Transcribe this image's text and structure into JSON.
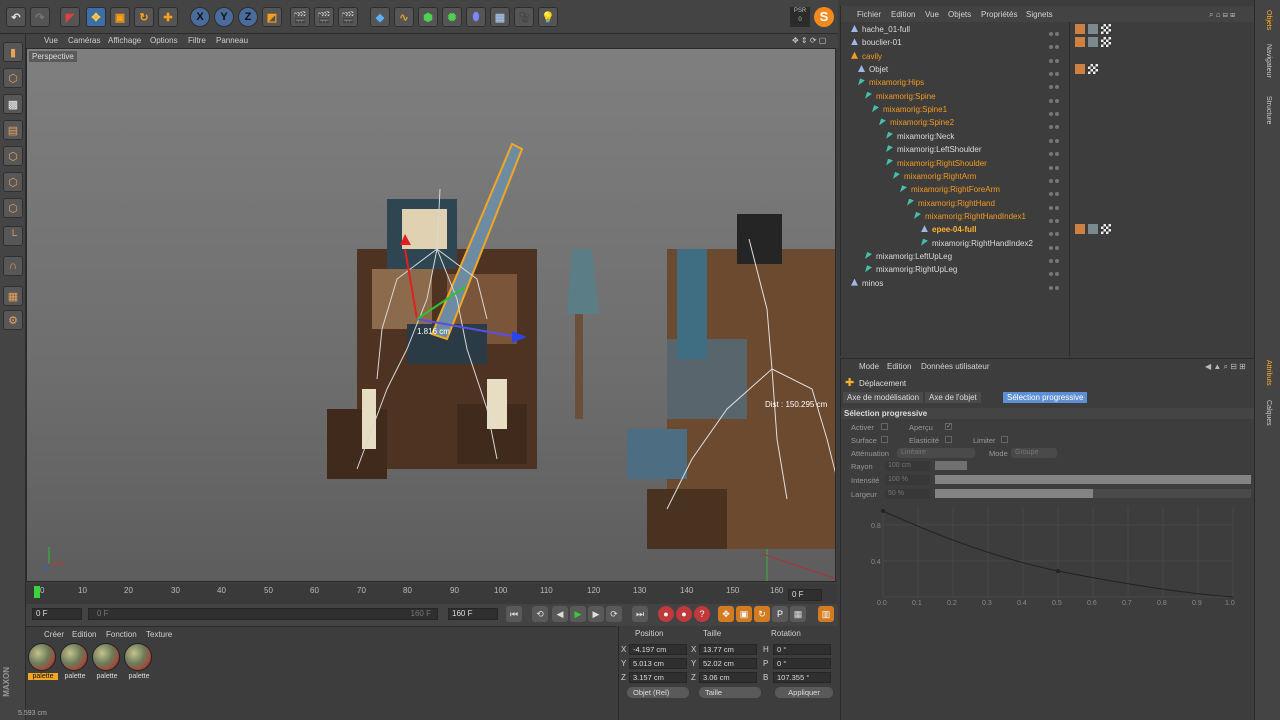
{
  "viewport": {
    "menu": [
      "Vue",
      "Caméras",
      "Affichage",
      "Options",
      "Filtre",
      "Panneau"
    ],
    "label": "Perspective",
    "dist_label_1": "1.816 cm",
    "dist_label_2": "Dist : 150.295 cm"
  },
  "toolbar": {
    "axis_x": "X",
    "axis_y": "Y",
    "axis_z": "Z",
    "logo": "S"
  },
  "timeline": {
    "ticks": [
      "0",
      "10",
      "20",
      "30",
      "40",
      "50",
      "60",
      "70",
      "80",
      "90",
      "100",
      "110",
      "120",
      "130",
      "140",
      "150",
      "160"
    ],
    "current_frame": "0 F",
    "start_field": "0 F",
    "range_start": "0 F",
    "range_end": "160 F",
    "end_field": "160 F"
  },
  "materials": {
    "menu": [
      "Créer",
      "Edition",
      "Fonction",
      "Texture"
    ],
    "items": [
      "palette",
      "palette",
      "palette",
      "palette"
    ]
  },
  "coords": {
    "headers": {
      "position": "Position",
      "size": "Taille",
      "rotation": "Rotation"
    },
    "rows": [
      {
        "axis": "X",
        "pos": "-4.197 cm",
        "size_axis": "X",
        "size": "13.77 cm",
        "rot_axis": "H",
        "rot": "0 °"
      },
      {
        "axis": "Y",
        "pos": "5.013 cm",
        "size_axis": "Y",
        "size": "52.02 cm",
        "rot_axis": "P",
        "rot": "0 °"
      },
      {
        "axis": "Z",
        "pos": "3.157 cm",
        "size_axis": "Z",
        "size": "3.06 cm",
        "rot_axis": "B",
        "rot": "107.355 °"
      }
    ],
    "mode_dropdown": "Objet (Rel)",
    "size_dropdown": "Taille",
    "apply_button": "Appliquer"
  },
  "objects": {
    "menu": [
      "Fichier",
      "Edition",
      "Vue",
      "Objets",
      "Propriétés",
      "Signets"
    ],
    "rows": [
      {
        "name": "hache_01-full",
        "style": "norm",
        "indent": 0
      },
      {
        "name": "bouclier-01",
        "style": "norm",
        "indent": 0
      },
      {
        "name": "cavily",
        "style": "hl",
        "indent": 0
      },
      {
        "name": "Objet",
        "style": "norm",
        "indent": 1
      },
      {
        "name": "mixamorig:Hips",
        "style": "hl",
        "indent": 1
      },
      {
        "name": "mixamorig:Spine",
        "style": "hl",
        "indent": 2
      },
      {
        "name": "mixamorig:Spine1",
        "style": "hl",
        "indent": 3
      },
      {
        "name": "mixamorig:Spine2",
        "style": "hl",
        "indent": 4
      },
      {
        "name": "mixamorig:Neck",
        "style": "norm",
        "indent": 5
      },
      {
        "name": "mixamorig:LeftShoulder",
        "style": "norm",
        "indent": 5
      },
      {
        "name": "mixamorig:RightShoulder",
        "style": "hl",
        "indent": 5
      },
      {
        "name": "mixamorig:RightArm",
        "style": "hl",
        "indent": 6
      },
      {
        "name": "mixamorig:RightForeArm",
        "style": "hl",
        "indent": 7
      },
      {
        "name": "mixamorig:RightHand",
        "style": "hl",
        "indent": 8
      },
      {
        "name": "mixamorig:RightHandIndex1",
        "style": "hl",
        "indent": 9
      },
      {
        "name": "epee-04-full",
        "style": "sel",
        "indent": 10
      },
      {
        "name": "mixamorig:RightHandIndex2",
        "style": "norm",
        "indent": 10
      },
      {
        "name": "mixamorig:LeftUpLeg",
        "style": "norm",
        "indent": 2
      },
      {
        "name": "mixamorig:RightUpLeg",
        "style": "norm",
        "indent": 2
      },
      {
        "name": "minos",
        "style": "norm",
        "indent": 0
      }
    ]
  },
  "attributes": {
    "menu": [
      "Mode",
      "Edition",
      "Données utilisateur"
    ],
    "tool_title": "Déplacement",
    "tabs": [
      "Axe de modélisation",
      "Axe de l'objet",
      "Sélection progressive"
    ],
    "section_title": "Sélection progressive",
    "labels": {
      "activer": "Activer",
      "apercu": "Aperçu",
      "surface": "Surface",
      "elasticite": "Elasticité",
      "limiter": "Limiter",
      "attenuation": "Atténuation",
      "attenuation_value": "Linéaire",
      "mode": "Mode",
      "mode_value": "Groupe",
      "rayon": "Rayon",
      "rayon_value": "100 cm",
      "intensite": "Intensité",
      "intensite_value": "100 %",
      "largeur": "Largeur",
      "largeur_value": "50 %"
    },
    "graph_y": [
      "0.8",
      "0.4"
    ],
    "graph_x": [
      "0.0",
      "0.1",
      "0.2",
      "0.3",
      "0.4",
      "0.5",
      "0.6",
      "0.7",
      "0.8",
      "0.9",
      "1.0"
    ]
  },
  "right_tabs": [
    "Objets",
    "Navigateur",
    "Structure",
    "Attributs",
    "Calques"
  ],
  "status": "5.593 cm"
}
